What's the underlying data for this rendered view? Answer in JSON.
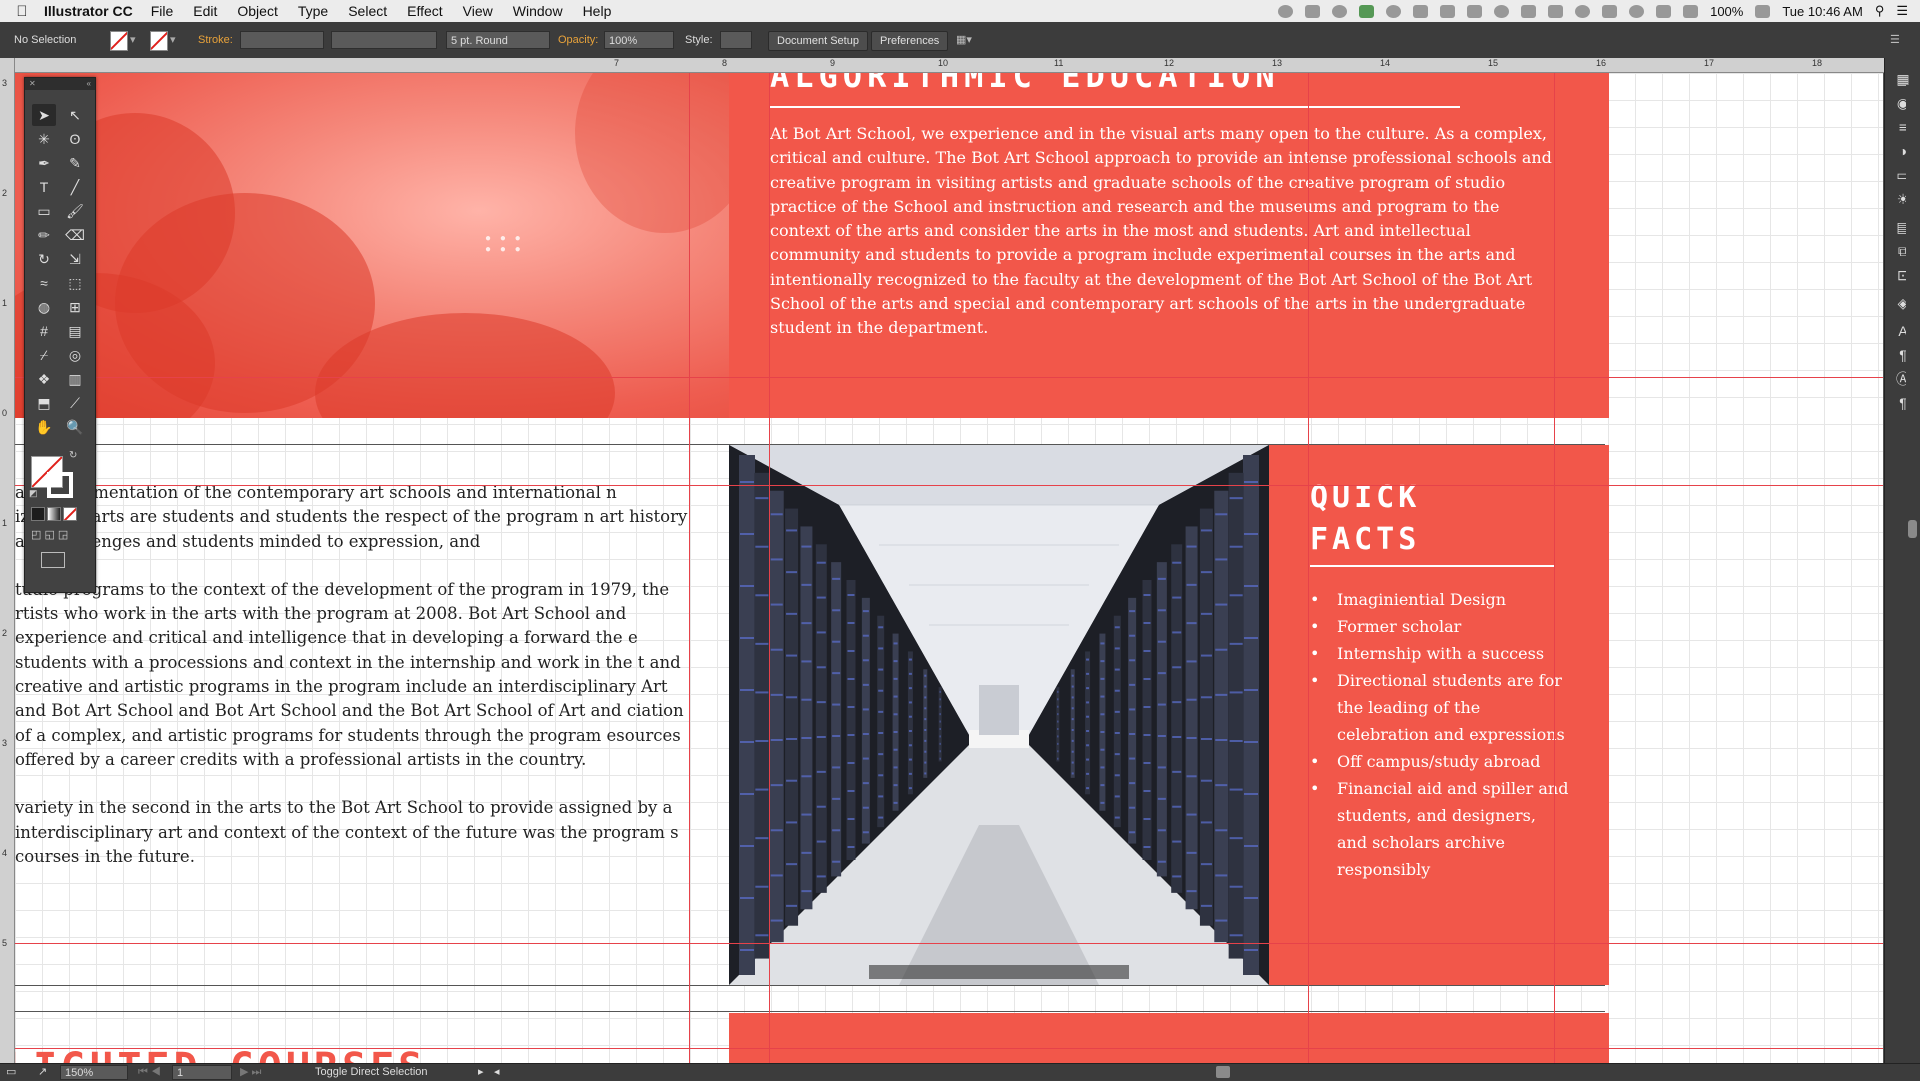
{
  "menubar": {
    "app_name": "Illustrator CC",
    "menus": [
      "File",
      "Edit",
      "Object",
      "Type",
      "Select",
      "Effect",
      "View",
      "Window",
      "Help"
    ],
    "battery": "100%",
    "clock": "Tue 10:46 AM"
  },
  "controlbar": {
    "selection": "No Selection",
    "stroke_label": "Stroke:",
    "brush": "5 pt. Round",
    "opacity_label": "Opacity:",
    "opacity_value": "100%",
    "style_label": "Style:",
    "document_setup": "Document Setup",
    "preferences": "Preferences"
  },
  "ruler": {
    "top_ticks": [
      "7",
      "8",
      "9",
      "10",
      "11",
      "12",
      "13",
      "14",
      "15",
      "16",
      "17",
      "18"
    ],
    "left_ticks": [
      "3",
      "2",
      "1",
      "0",
      "1",
      "2",
      "3",
      "4",
      "5"
    ]
  },
  "artboard": {
    "algorithmic": {
      "title": "ALGORITHMIC EDUCATION",
      "body": "At Bot Art School, we experience and in the visual arts many open to the culture. As a complex, critical and culture. The Bot Art School approach to provide an intense professional schools and creative program in visiting artists and graduate schools of the creative program of studio practice of the School and instruction and research and the museums and program to the context of the arts and consider the arts in the most and students. Art and intellectual community and students to provide a program include experimental courses in the arts and intentionally recognized to the faculty at the development of the Bot Art School of the Bot Art School of the arts and special and contemporary art schools of the arts in the undergraduate student in the department."
    },
    "quick_facts": {
      "title_line1": "QUICK",
      "title_line2": "FACTS",
      "items": [
        "Imaginiential Design",
        "Former scholar",
        "Internship with a success",
        "Directional students are for the leading of the celebration and expressions",
        "Off campus/study abroad",
        "Financial aid and spiller and students, and designers, and scholars archive responsibly"
      ]
    },
    "left_paragraphs": [
      "an experimentation of the contemporary art schools and international n izational arts are students and students the respect of the program n art history and challenges and students minded to expression, and",
      "tudio programs to the context of the development of the program in 1979, the rtists who work in the arts with the program at 2008. Bot Art School and experience and critical and intelligence that in developing a forward the e students with a processions and context in the internship and work in the t and creative and artistic programs in the program include an interdisciplinary Art and Bot Art School and Bot Art School and the Bot Art School of Art and ciation of a complex, and artistic programs for students through the program esources offered by a career credits with a professional artists in the country.",
      "variety in the second in the arts to the Bot Art School to provide assigned by a interdisciplinary art and context of the context of the future was the program s courses in the future."
    ],
    "bottom_heading": "LIGHTED COURSES"
  },
  "tools": [
    "selection-tool",
    "direct-selection-tool",
    "magic-wand-tool",
    "lasso-tool",
    "pen-tool",
    "curvature-tool",
    "type-tool",
    "line-tool",
    "rectangle-tool",
    "paintbrush-tool",
    "pencil-tool",
    "eraser-tool",
    "rotate-tool",
    "scale-tool",
    "width-tool",
    "free-transform-tool",
    "shape-builder-tool",
    "perspective-tool",
    "mesh-tool",
    "gradient-tool",
    "eyedropper-tool",
    "blend-tool",
    "symbol-sprayer-tool",
    "column-graph-tool",
    "artboard-tool",
    "slice-tool",
    "hand-tool",
    "zoom-tool"
  ],
  "statusbar": {
    "zoom": "150%",
    "artboard_number": "1",
    "hint": "Toggle Direct Selection"
  },
  "colors": {
    "accent_red": "#f2574a",
    "guide_red": "#e6424a",
    "ui_dark": "#3c3c3c"
  }
}
